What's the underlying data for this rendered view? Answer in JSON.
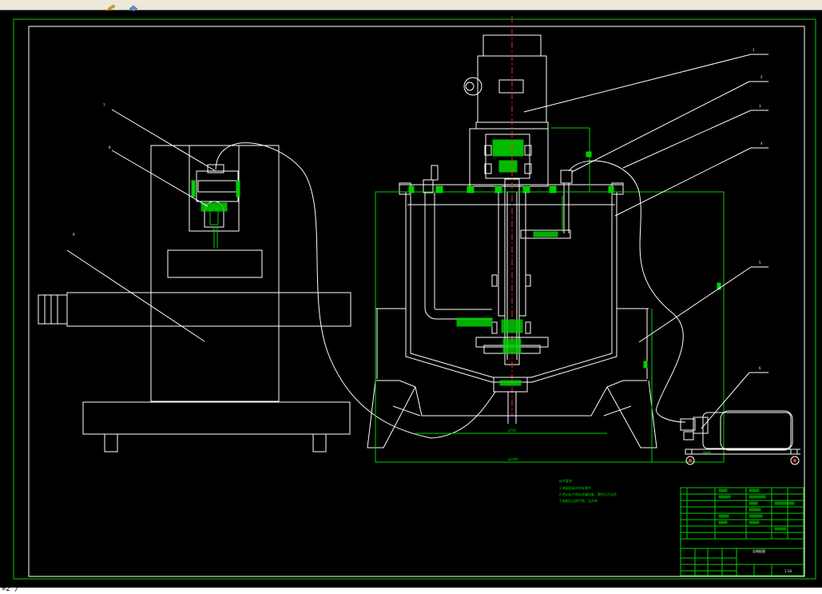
{
  "toolbar": {
    "icons": [
      "pencil-icon",
      "layer-icon"
    ]
  },
  "command_line": {
    "prompt": "=2 /"
  },
  "drawing": {
    "tech_notes_title": "技术要求:",
    "tech_notes_lines": [
      "1.装配前清洗所有零件",
      "2.密封处不得有渗漏现象，需作压力试验",
      "3.装配后运转平稳，无异响"
    ],
    "dim_inner": "φ740",
    "dim_outer": "φ1090",
    "callouts": [
      "1",
      "2",
      "3",
      "4",
      "5",
      "6",
      "7",
      "8",
      "9"
    ],
    "title_block": {
      "drawing_title": "总装配图",
      "scale": "1:10"
    }
  }
}
